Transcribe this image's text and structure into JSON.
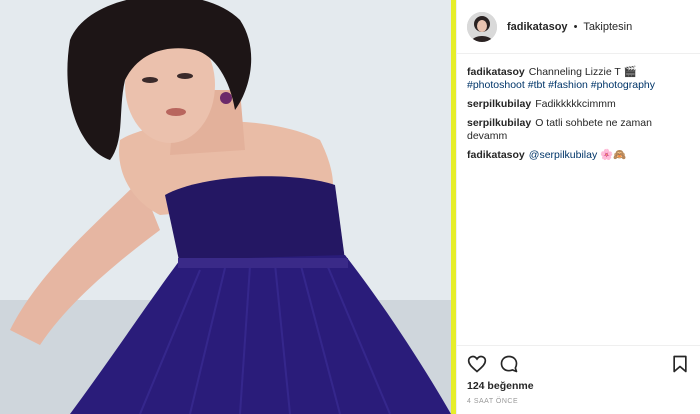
{
  "post": {
    "username": "fadikatasoy",
    "follow_status": "Takiptesin",
    "separator": "•"
  },
  "caption": {
    "username": "fadikatasoy",
    "text": "Channeling Lizzie T",
    "emoji": "🎬",
    "hashtags": [
      "#photoshoot",
      "#tbt",
      "#fashion",
      "#photography"
    ]
  },
  "comments": [
    {
      "username": "serpilkubilay",
      "text": "Fadikkkkkcimmm"
    },
    {
      "username": "serpilkubilay",
      "text": "O tatli sohbete ne zaman devamm"
    },
    {
      "username": "fadikatasoy",
      "mention": "@serpilkubilay",
      "emoji": "🌸🙈"
    }
  ],
  "actions": {
    "like_icon": "heart-icon",
    "comment_icon": "comment-bubble-icon",
    "save_icon": "bookmark-icon"
  },
  "stats": {
    "likes": "124 beğenme",
    "time": "4 SAAT ÖNCE"
  },
  "colors": {
    "accent_divider": "#e6ee2a",
    "hashtag": "#003569",
    "dress": "#2a1c7a"
  }
}
